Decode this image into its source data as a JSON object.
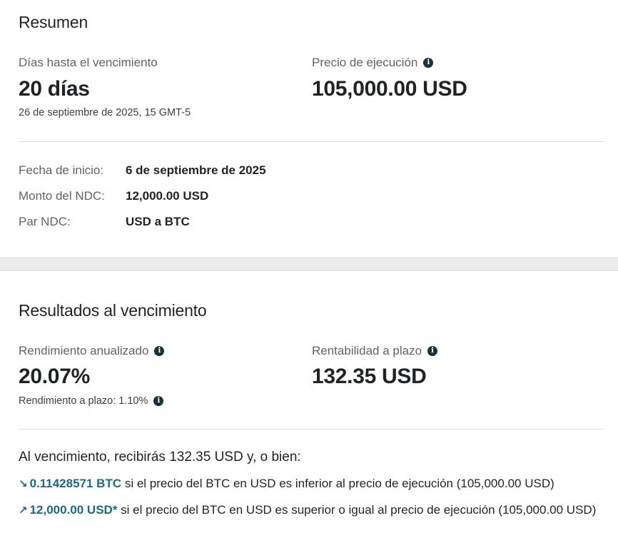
{
  "summary": {
    "title": "Resumen",
    "days_label": "Días hasta el vencimiento",
    "days_value": "20 días",
    "expiry_date": "26 de septiembre de 2025, 15 GMT-5",
    "strike_label": "Precio de ejecución",
    "strike_value": "105,000.00 USD",
    "details": [
      {
        "key": "Fecha de inicio",
        "value": "6 de septiembre de 2025"
      },
      {
        "key": "Monto del NDC",
        "value": "12,000.00 USD"
      },
      {
        "key": "Par NDC",
        "value": "USD a BTC"
      }
    ]
  },
  "results": {
    "title": "Resultados al vencimiento",
    "annual_label": "Rendimiento anualizado",
    "annual_value": "20.07%",
    "term_yield_label": "Rendimiento a plazo",
    "term_yield_value": "1.10%",
    "profit_label": "Rentabilidad a plazo",
    "profit_value": "132.35 USD",
    "outcome_title": "Al vencimiento, recibirás 132.35 USD y, o bien:",
    "outcomes": [
      {
        "arrow": "↘",
        "amount": "0.11428571 BTC",
        "text": " si el precio del BTC en USD es inferior al precio de ejecución (105,000.00 USD)"
      },
      {
        "arrow": "↗",
        "amount": "12,000.00 USD*",
        "text": " si el precio del BTC en USD es superior o igual al precio de ejecución (105,000.00 USD)"
      }
    ]
  },
  "icons": {
    "info": "info-icon"
  },
  "colors": {
    "accent": "#1b6b82",
    "info_icon": "#17333a",
    "muted": "#5f6368"
  }
}
